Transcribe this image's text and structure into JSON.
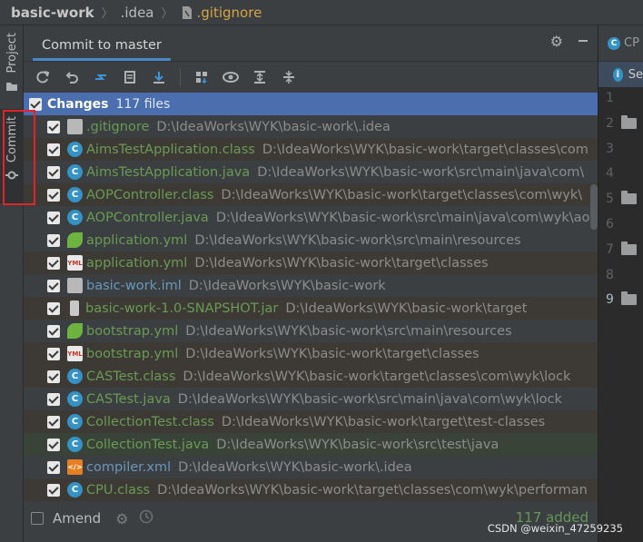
{
  "breadcrumb": [
    "basic-work",
    ".idea",
    ".gitignore"
  ],
  "left_strip": {
    "project_label": "Project",
    "commit_label": "Commit"
  },
  "panel": {
    "tab_label": "Commit to master",
    "header_icons": [
      "gear-icon",
      "minimize-icon"
    ]
  },
  "toolbar": [
    "refresh-icon",
    "rollback-icon",
    "diff-icon",
    "shelve-icon",
    "update-icon",
    "group-by-icon",
    "show-diff-icon",
    "expand-all-icon",
    "collapse-all-icon"
  ],
  "changes": {
    "label": "Changes",
    "count": "117 files",
    "files": [
      {
        "name": ".gitignore",
        "path": "D:\\IdeaWorks\\WYK\\basic-work\\.idea",
        "icon": "file",
        "color": "green",
        "bg": ""
      },
      {
        "name": "AimsTestApplication.class",
        "path": "D:\\IdeaWorks\\WYK\\basic-work\\target\\classes\\com",
        "icon": "class",
        "color": "green",
        "bg": "brown"
      },
      {
        "name": "AimsTestApplication.java",
        "path": "D:\\IdeaWorks\\WYK\\basic-work\\src\\main\\java\\com\\",
        "icon": "java",
        "color": "green",
        "bg": ""
      },
      {
        "name": "AOPController.class",
        "path": "D:\\IdeaWorks\\WYK\\basic-work\\target\\classes\\com\\wyk\\",
        "icon": "class",
        "color": "green",
        "bg": "brown"
      },
      {
        "name": "AOPController.java",
        "path": "D:\\IdeaWorks\\WYK\\basic-work\\src\\main\\java\\com\\wyk\\ao",
        "icon": "java",
        "color": "green",
        "bg": ""
      },
      {
        "name": "application.yml",
        "path": "D:\\IdeaWorks\\WYK\\basic-work\\src\\main\\resources",
        "icon": "spring",
        "color": "green",
        "bg": ""
      },
      {
        "name": "application.yml",
        "path": "D:\\IdeaWorks\\WYK\\basic-work\\target\\classes",
        "icon": "yml",
        "color": "green",
        "bg": "brown"
      },
      {
        "name": "basic-work.iml",
        "path": "D:\\IdeaWorks\\WYK\\basic-work",
        "icon": "file",
        "color": "blue",
        "bg": ""
      },
      {
        "name": "basic-work-1.0-SNAPSHOT.jar",
        "path": "D:\\IdeaWorks\\WYK\\basic-work\\target",
        "icon": "jar",
        "color": "green",
        "bg": "brown"
      },
      {
        "name": "bootstrap.yml",
        "path": "D:\\IdeaWorks\\WYK\\basic-work\\src\\main\\resources",
        "icon": "spring",
        "color": "green",
        "bg": ""
      },
      {
        "name": "bootstrap.yml",
        "path": "D:\\IdeaWorks\\WYK\\basic-work\\target\\classes",
        "icon": "yml",
        "color": "green",
        "bg": "brown"
      },
      {
        "name": "CASTest.class",
        "path": "D:\\IdeaWorks\\WYK\\basic-work\\target\\classes\\com\\wyk\\lock",
        "icon": "class",
        "color": "green",
        "bg": "brown"
      },
      {
        "name": "CASTest.java",
        "path": "D:\\IdeaWorks\\WYK\\basic-work\\src\\main\\java\\com\\wyk\\lock",
        "icon": "java",
        "color": "green",
        "bg": ""
      },
      {
        "name": "CollectionTest.class",
        "path": "D:\\IdeaWorks\\WYK\\basic-work\\target\\test-classes",
        "icon": "class",
        "color": "green",
        "bg": "brown"
      },
      {
        "name": "CollectionTest.java",
        "path": "D:\\IdeaWorks\\WYK\\basic-work\\src\\test\\java",
        "icon": "java",
        "color": "green",
        "bg": "green"
      },
      {
        "name": "compiler.xml",
        "path": "D:\\IdeaWorks\\WYK\\basic-work\\.idea",
        "icon": "xml",
        "color": "blue",
        "bg": ""
      },
      {
        "name": "CPU.class",
        "path": "D:\\IdeaWorks\\WYK\\basic-work\\target\\classes\\com\\wyk\\performan",
        "icon": "class",
        "color": "green",
        "bg": "brown"
      }
    ]
  },
  "footer": {
    "amend_label": "Amend",
    "added_text": "117 added"
  },
  "editor": {
    "tab_label": "CP",
    "notice_text": "Se",
    "line_numbers": [
      "1",
      "2",
      "3",
      "4",
      "5",
      "6",
      "7",
      "8",
      "9"
    ]
  },
  "watermark": "CSDN @weixin_47259235",
  "colors": {
    "accent": "#4b6eaf",
    "added": "#629755",
    "highlight_box": "#e0242a"
  }
}
